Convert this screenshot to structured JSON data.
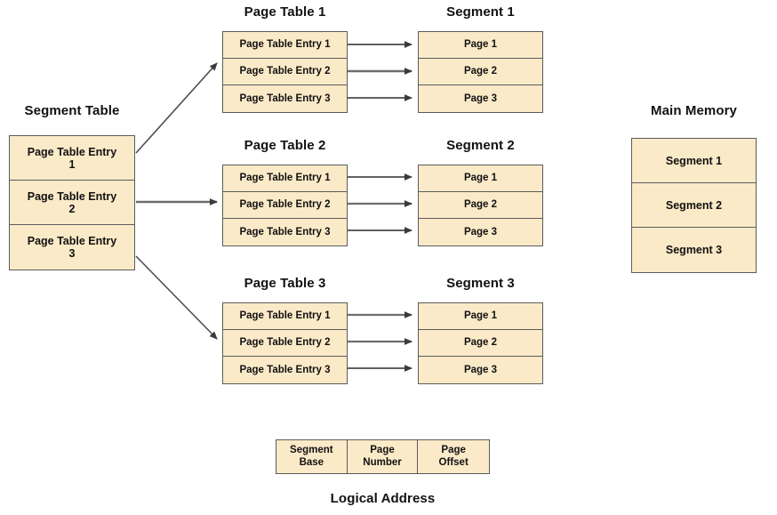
{
  "diagram": {
    "segment_table": {
      "title": "Segment Table",
      "entries": [
        "Page Table Entry\n1",
        "Page Table Entry\n2",
        "Page Table Entry\n3"
      ]
    },
    "page_tables": [
      {
        "title": "Page Table 1",
        "entries": [
          "Page Table Entry 1",
          "Page Table Entry 2",
          "Page Table Entry 3"
        ]
      },
      {
        "title": "Page Table 2",
        "entries": [
          "Page Table Entry 1",
          "Page Table Entry 2",
          "Page Table Entry 3"
        ]
      },
      {
        "title": "Page Table 3",
        "entries": [
          "Page Table Entry 1",
          "Page Table Entry 2",
          "Page Table Entry 3"
        ]
      }
    ],
    "segments": [
      {
        "title": "Segment 1",
        "pages": [
          "Page 1",
          "Page 2",
          "Page 3"
        ]
      },
      {
        "title": "Segment 2",
        "pages": [
          "Page 1",
          "Page 2",
          "Page 3"
        ]
      },
      {
        "title": "Segment 3",
        "pages": [
          "Page 1",
          "Page 2",
          "Page 3"
        ]
      }
    ],
    "main_memory": {
      "title": "Main Memory",
      "segments": [
        "Segment 1",
        "Segment 2",
        "Segment 3"
      ]
    },
    "logical_address": {
      "caption": "Logical Address",
      "fields": [
        "Segment\nBase",
        "Page\nNumber",
        "Page\nOffset"
      ]
    },
    "colors": {
      "box_fill": "#fbeac8",
      "box_border": "#5b5b5b",
      "arrow": "#4d4d4d",
      "text": "#111111",
      "background": "#ffffff"
    }
  }
}
